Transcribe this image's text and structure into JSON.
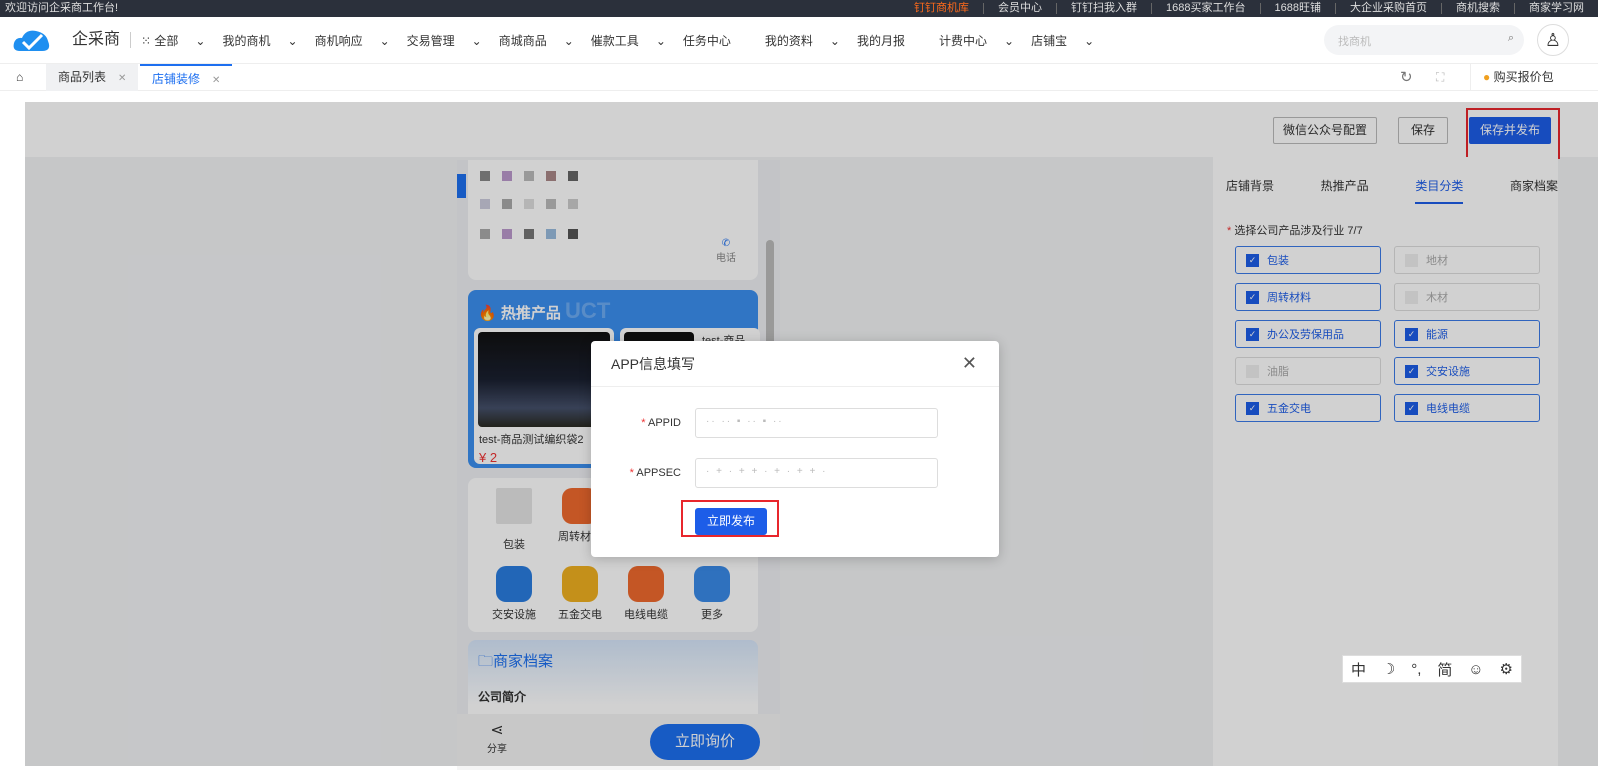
{
  "topbar": {
    "welcome": "欢迎访问企采商工作台!",
    "links": [
      "钉钉商机库",
      "会员中心",
      "钉钉扫我入群",
      "1688买家工作台",
      "1688旺铺",
      "大企业采购首页",
      "商机搜索",
      "商家学习网"
    ]
  },
  "nav": {
    "brand": "企采商",
    "menu": [
      "全部",
      "我的商机",
      "商机响应",
      "交易管理",
      "商城商品",
      "催款工具",
      "任务中心",
      "我的资料",
      "我的月报",
      "计费中心",
      "店铺宝"
    ],
    "search_placeholder": "找商机"
  },
  "tabs": {
    "items": [
      "商品列表",
      "店铺装修"
    ],
    "active": "店铺装修",
    "buy": "购买报价包"
  },
  "toolbar": {
    "wechat": "微信公众号配置",
    "save": "保存",
    "save_publish": "保存并发布"
  },
  "preview": {
    "phone_label": "电话",
    "hot_title": "热推产品",
    "hot_watermark": "UCT",
    "product1_name": "test-商品测试编织袋2",
    "product1_price": "¥ 2",
    "product2_name": "test-商品",
    "categories": [
      "包装",
      "周转材料",
      "交安设施",
      "五金交电",
      "电线电缆",
      "更多"
    ],
    "profile_title": "商家档案",
    "profile_sub": "公司简介",
    "share": "分享",
    "inquire": "立即询价"
  },
  "panel": {
    "tabs": [
      "店铺背景",
      "热推产品",
      "类目分类",
      "商家档案"
    ],
    "active_tab": "类目分类",
    "required_label": "选择公司产品涉及行业 7/7",
    "options": [
      {
        "label": "包装",
        "checked": true
      },
      {
        "label": "地材",
        "checked": false
      },
      {
        "label": "周转材料",
        "checked": true
      },
      {
        "label": "木材",
        "checked": false
      },
      {
        "label": "办公及劳保用品",
        "checked": true
      },
      {
        "label": "能源",
        "checked": true
      },
      {
        "label": "油脂",
        "checked": false
      },
      {
        "label": "交安设施",
        "checked": true
      },
      {
        "label": "五金交电",
        "checked": true
      },
      {
        "label": "电线电缆",
        "checked": true
      }
    ]
  },
  "modal": {
    "title": "APP信息填写",
    "appid_label": "APPID",
    "appsec_label": "APPSEC",
    "appid_value": "·· ·· ▪ ·· ▪ ··",
    "appsec_value": "· + · + + · + · + + ·",
    "publish": "立即发布"
  },
  "ime": {
    "items": [
      "中",
      "☽",
      "°,",
      "简",
      "☺",
      "⚙"
    ]
  }
}
